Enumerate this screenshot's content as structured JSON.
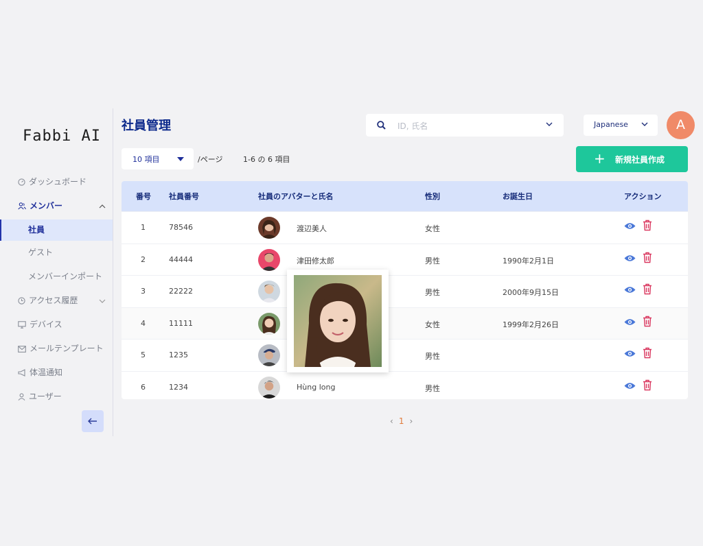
{
  "brand": {
    "logo_text": "Fabbi AI"
  },
  "sidebar": {
    "items": [
      {
        "label": "ダッシュボード",
        "icon": "dashboard-icon"
      },
      {
        "label": "メンバー",
        "icon": "members-icon",
        "expanded": true
      },
      {
        "label": "社員",
        "icon": "",
        "active": true
      },
      {
        "label": "ゲスト",
        "icon": ""
      },
      {
        "label": "メンバーインポート",
        "icon": ""
      },
      {
        "label": "アクセス履歴",
        "icon": "clock-icon"
      },
      {
        "label": "デバイス",
        "icon": "monitor-icon"
      },
      {
        "label": "メールテンプレート",
        "icon": "mail-icon"
      },
      {
        "label": "体温通知",
        "icon": "megaphone-icon"
      },
      {
        "label": "ユーザー",
        "icon": "user-icon"
      }
    ]
  },
  "header": {
    "title": "社員管理",
    "search_placeholder": "ID, 氏名",
    "language": "Japanese",
    "user_initial": "A"
  },
  "toolbar": {
    "page_size": "10 項目",
    "per_page": "/ページ",
    "range": "1-6 の 6 項目",
    "create_label": "新規社員作成",
    "create_plus": "+"
  },
  "table": {
    "columns": [
      "番号",
      "社員番号",
      "社員のアバターと氏名",
      "性別",
      "お誕生日",
      "アクション"
    ],
    "rows": [
      {
        "no": "1",
        "emp_id": "78546",
        "name": "渡辺美人",
        "gender": "女性",
        "birthday": ""
      },
      {
        "no": "2",
        "emp_id": "44444",
        "name": "津田修太郎",
        "gender": "男性",
        "birthday": "1990年2月1日"
      },
      {
        "no": "3",
        "emp_id": "22222",
        "name": "",
        "gender": "男性",
        "birthday": "2000年9月15日"
      },
      {
        "no": "4",
        "emp_id": "11111",
        "name": "",
        "gender": "女性",
        "birthday": "1999年2月26日"
      },
      {
        "no": "5",
        "emp_id": "1235",
        "name": "",
        "gender": "男性",
        "birthday": ""
      },
      {
        "no": "6",
        "emp_id": "1234",
        "name": "Hùng long",
        "gender": "男性",
        "birthday": ""
      }
    ]
  },
  "pagination": {
    "current": "1",
    "prev": "‹",
    "next": "›"
  },
  "colors": {
    "accent": "#1ec79b",
    "primary": "#0d2a8c",
    "header_bg": "#d7e2fb",
    "danger": "#d9365e",
    "view": "#4a78d8"
  }
}
